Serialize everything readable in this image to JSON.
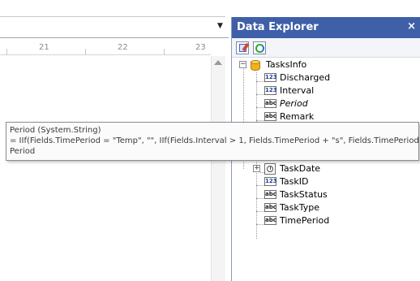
{
  "ruler": {
    "ticks": [
      "21",
      "22",
      "23"
    ]
  },
  "panel": {
    "title": "Data Explorer",
    "close_glyph": "×",
    "toolbar": {
      "edit_icon": "edit-icon",
      "refresh_icon": "refresh-icon"
    }
  },
  "tree": {
    "root": {
      "label": "TasksInfo",
      "icon": "database-icon"
    },
    "items": [
      {
        "label": "Discharged",
        "type": "123"
      },
      {
        "label": "Interval",
        "type": "123"
      },
      {
        "label": "Period",
        "type": "abc",
        "italic": true
      },
      {
        "label": "Remark",
        "type": "abc"
      },
      {
        "label": "TaskDate",
        "type": "clock"
      },
      {
        "label": "TaskID",
        "type": "123"
      },
      {
        "label": "TaskStatus",
        "type": "abc"
      },
      {
        "label": "TaskType",
        "type": "abc"
      },
      {
        "label": "TimePeriod",
        "type": "abc"
      }
    ]
  },
  "tooltip": {
    "line1": "Period (System.String)",
    "line2": "= IIf(Fields.TimePeriod = \"Temp\", \"\", IIf(Fields.Interval > 1, Fields.TimePeriod + \"s\", Fields.TimePeriod))",
    "line3": "Period"
  },
  "colors": {
    "panel_header": "#3f5fa8",
    "panel_border": "#8b9bb6"
  }
}
